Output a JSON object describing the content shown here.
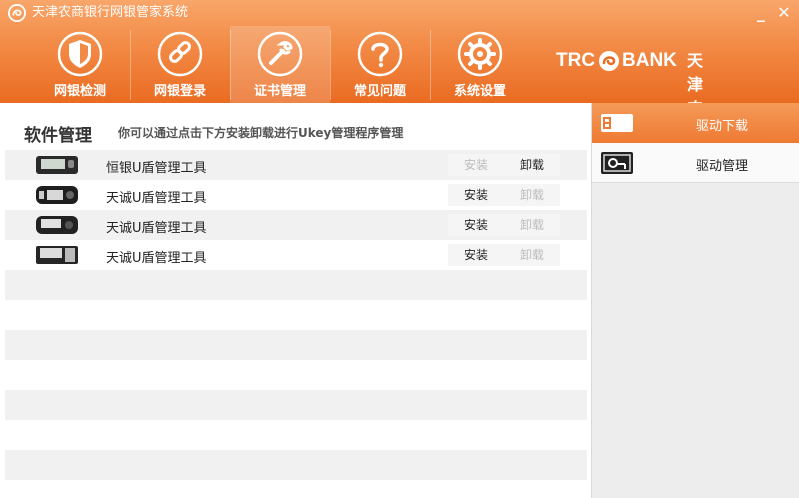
{
  "window": {
    "title": "天津农商银行网银管家系统",
    "minimize_glyph": "_",
    "close_glyph": "✕"
  },
  "nav": {
    "items": [
      {
        "label": "网银检测",
        "icon": "shield-icon",
        "active": false
      },
      {
        "label": "网银登录",
        "icon": "link-icon",
        "active": false
      },
      {
        "label": "证书管理",
        "icon": "wrench-icon",
        "active": true
      },
      {
        "label": "常见问题",
        "icon": "question-icon",
        "active": false
      },
      {
        "label": "系统设置",
        "icon": "gear-icon",
        "active": false
      }
    ]
  },
  "brand": {
    "en_part1": "TRC",
    "en_part2": "BANK",
    "cn": "天津农商银行"
  },
  "main": {
    "title": "软件管理",
    "description": "你可以通过点击下方安装卸载进行Ukey管理程序管理",
    "rows": [
      {
        "name": "恒银U盾管理工具",
        "install": "安装",
        "uninstall": "卸载",
        "install_enabled": false,
        "uninstall_enabled": true
      },
      {
        "name": "天诚U盾管理工具",
        "install": "安装",
        "uninstall": "卸载",
        "install_enabled": true,
        "uninstall_enabled": false
      },
      {
        "name": "天诚U盾管理工具",
        "install": "安装",
        "uninstall": "卸载",
        "install_enabled": true,
        "uninstall_enabled": false
      },
      {
        "name": "天诚U盾管理工具",
        "install": "安装",
        "uninstall": "卸载",
        "install_enabled": true,
        "uninstall_enabled": false
      }
    ]
  },
  "side": {
    "items": [
      {
        "label": "驱动下载",
        "icon": "usb-drive-icon",
        "active": true
      },
      {
        "label": "驱动管理",
        "icon": "certificate-icon",
        "active": false
      }
    ]
  },
  "colors": {
    "header_top": "#f8a66a",
    "header_bottom": "#ea6b22",
    "row_alt": "#f1f1f1",
    "disabled_text": "#bbbbbb"
  }
}
